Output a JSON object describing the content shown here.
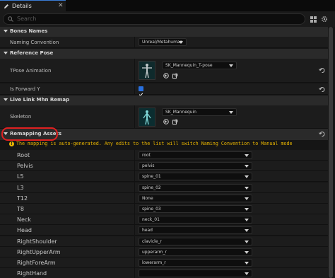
{
  "tab": {
    "title": "Details",
    "icon": "pencil-icon"
  },
  "search": {
    "placeholder": "Search"
  },
  "sections": {
    "bones_names": {
      "title": "Bones Names"
    },
    "reference_pose": {
      "title": "Reference Pose"
    },
    "live_link": {
      "title": "Live Link Mhn Remap"
    },
    "remapping": {
      "title": "Remapping Assets"
    }
  },
  "naming_convention": {
    "label": "Naming Convention",
    "value": "Unreal/Metahuman"
  },
  "tpose": {
    "label": "TPose Animation",
    "value": "SK_Mannequin_T-pose"
  },
  "forward_y": {
    "label": "Is Forward Y",
    "checked": true
  },
  "skeleton": {
    "label": "Skeleton",
    "value": "SK_Mannequin"
  },
  "warning": "The mapping is auto-generated. Any edits to the list will switch Naming Convention to Manual mode",
  "mappings": [
    {
      "name": "Root",
      "value": "root"
    },
    {
      "name": "Pelvis",
      "value": "pelvis"
    },
    {
      "name": "L5",
      "value": "spine_01"
    },
    {
      "name": "L3",
      "value": "spine_02"
    },
    {
      "name": "T12",
      "value": "None"
    },
    {
      "name": "T8",
      "value": "spine_03"
    },
    {
      "name": "Neck",
      "value": "neck_01"
    },
    {
      "name": "Head",
      "value": "head"
    },
    {
      "name": "RightShoulder",
      "value": "clavicle_r"
    },
    {
      "name": "RightUpperArm",
      "value": "upperarm_r"
    },
    {
      "name": "RightForeArm",
      "value": "lowerarm_r"
    },
    {
      "name": "RightHand",
      "value": ""
    }
  ],
  "colors": {
    "accent": "#2870e0",
    "warning": "#e8b400",
    "highlight": "#e02020"
  }
}
